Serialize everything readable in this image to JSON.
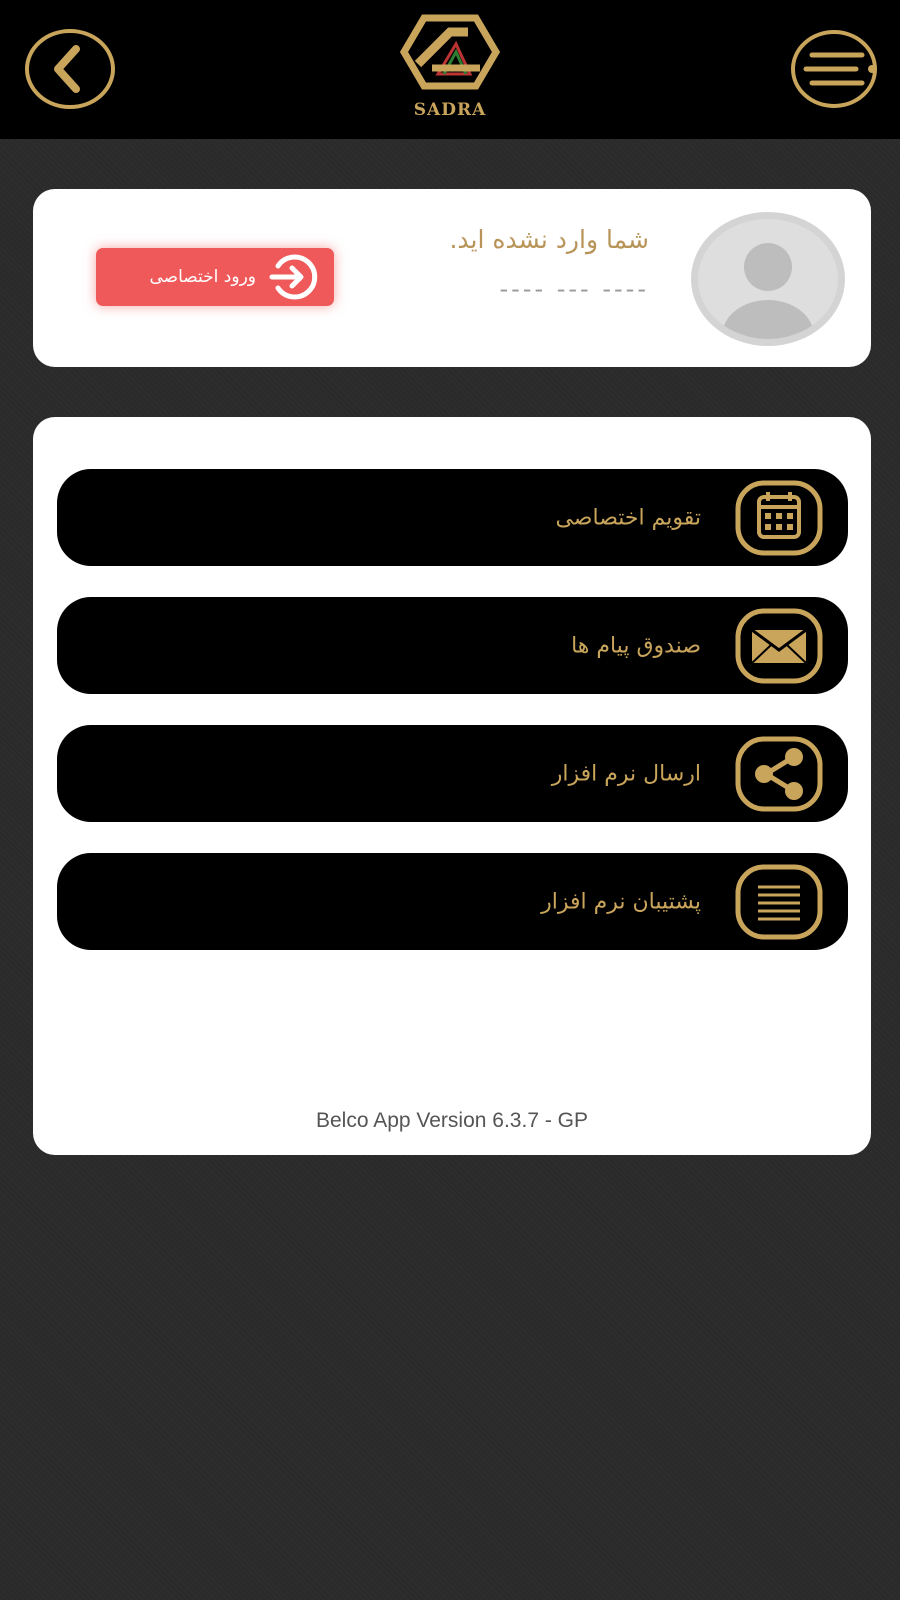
{
  "header": {
    "logo_text": "SADRA",
    "back_icon": "chevron-left-icon",
    "menu_icon": "hamburger-menu-icon"
  },
  "profile": {
    "status_text": "شما وارد نشده اید.",
    "id_placeholder": "---- --- ----",
    "login_button_label": "ورود اختصاصی",
    "login_icon": "login-arrow-icon",
    "avatar_icon": "user-avatar-icon"
  },
  "menu": {
    "items": [
      {
        "label": "تقویم اختصاصی",
        "icon": "calendar-icon"
      },
      {
        "label": "صندوق پیام ها",
        "icon": "envelope-icon"
      },
      {
        "label": "ارسال نرم افزار",
        "icon": "share-icon"
      },
      {
        "label": "پشتیبان نرم افزار",
        "icon": "list-lines-icon"
      }
    ]
  },
  "footer": {
    "version_text": "Belco App Version 6.3.7 - GP"
  },
  "colors": {
    "gold": "#c9a55c",
    "login_red": "#f0595a",
    "background": "#2a2a2a",
    "header_bg": "#000000"
  }
}
